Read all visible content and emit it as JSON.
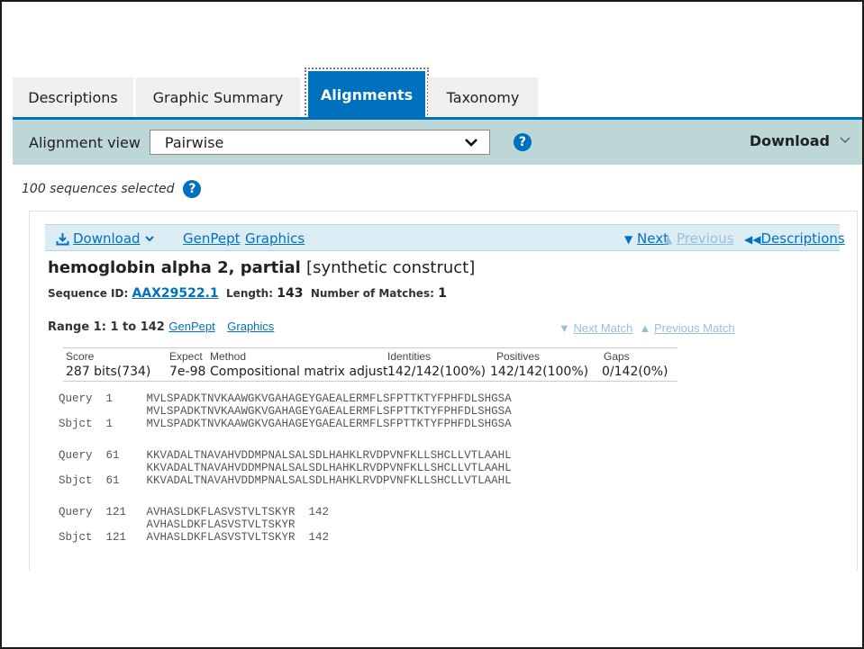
{
  "tabs": [
    {
      "label": "Descriptions"
    },
    {
      "label": "Graphic Summary"
    },
    {
      "label": "Alignments"
    },
    {
      "label": "Taxonomy"
    }
  ],
  "toolbar": {
    "alignment_view_label": "Alignment view",
    "alignment_view_value": "Pairwise",
    "download_label": "Download"
  },
  "selection": {
    "text": "100 sequences selected"
  },
  "actionbar": {
    "download": "Download",
    "genpept": "GenPept",
    "graphics": "Graphics",
    "next": "Next",
    "previous": "Previous",
    "descriptions": "Descriptions"
  },
  "hit": {
    "title": "hemoglobin alpha 2, partial",
    "title_suffix": "[synthetic construct]",
    "seq_id_label": "Sequence ID:",
    "seq_id": "AAX29522.1",
    "length_label": "Length:",
    "length": "143",
    "matches_label": "Number of Matches:",
    "matches": "1"
  },
  "range": {
    "label": "Range 1: 1 to 142",
    "genpept": "GenPept",
    "graphics": "Graphics",
    "next_match": "Next Match",
    "previous_match": "Previous Match"
  },
  "stats": {
    "headers": [
      "Score",
      "Expect",
      "Method",
      "Identities",
      "Positives",
      "Gaps"
    ],
    "values": [
      "287 bits(734)",
      "7e-98",
      "Compositional matrix adjust.",
      "142/142(100%)",
      "142/142(100%)",
      "0/142(0%)"
    ]
  },
  "alignment": [
    {
      "query": "Query  1     MVLSPADKTNVKAAWGKVGAHAGEYGAEALERMFLSFPTTKTYFPHFDLSHGSA",
      "mid": "             MVLSPADKTNVKAAWGKVGAHAGEYGAEALERMFLSFPTTKTYFPHFDLSHGSA",
      "sbjct": "Sbjct  1     MVLSPADKTNVKAAWGKVGAHAGEYGAEALERMFLSFPTTKTYFPHFDLSHGSA"
    },
    {
      "query": "Query  61    KKVADALTNAVAHVDDMPNALSALSDLHAHKLRVDPVNFKLLSHCLLVTLAAHL",
      "mid": "             KKVADALTNAVAHVDDMPNALSALSDLHAHKLRVDPVNFKLLSHCLLVTLAAHL",
      "sbjct": "Sbjct  61    KKVADALTNAVAHVDDMPNALSALSDLHAHKLRVDPVNFKLLSHCLLVTLAAHL"
    },
    {
      "query": "Query  121   AVHASLDKFLASVSTVLTSKYR  142",
      "mid": "             AVHASLDKFLASVSTVLTSKYR",
      "sbjct": "Sbjct  121   AVHASLDKFLASVSTVLTSKYR  142"
    }
  ],
  "colors": {
    "primary": "#0071bc",
    "toolbar_bg": "#bdd6d6",
    "actionbar_bg": "#dcecf5",
    "tab_bg": "#f0f0f0"
  }
}
